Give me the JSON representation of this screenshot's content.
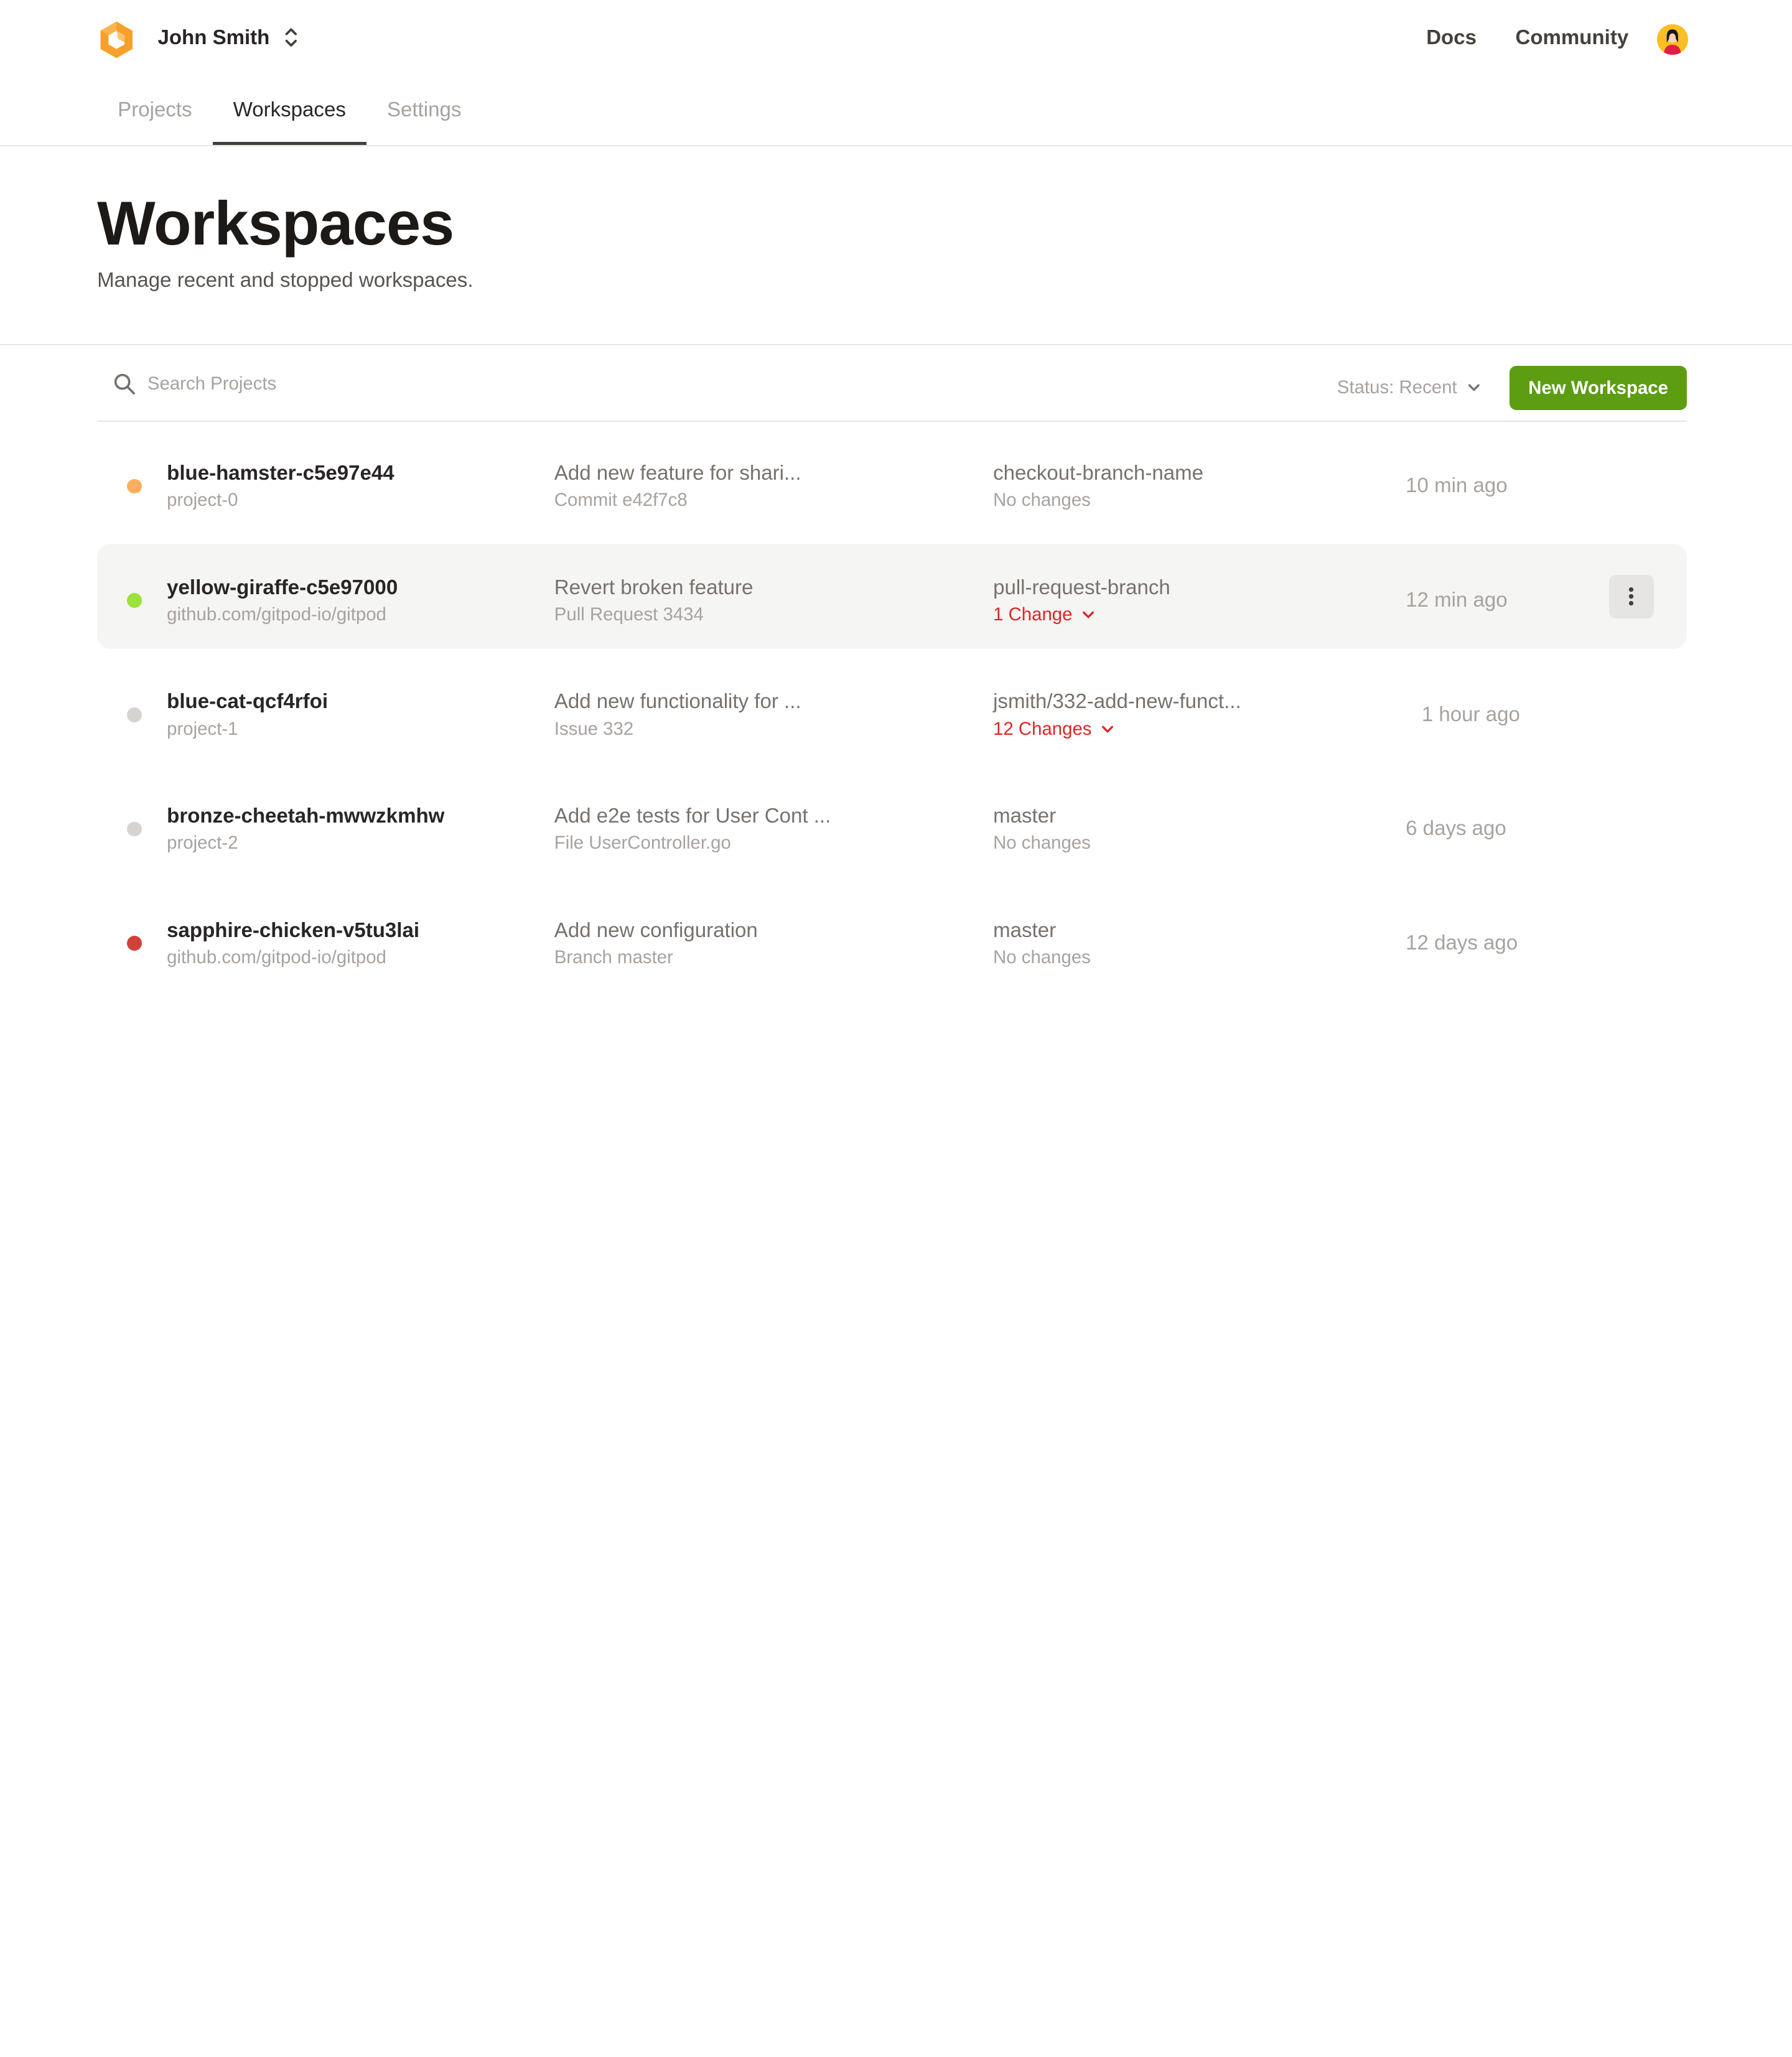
{
  "header": {
    "account_name": "John Smith",
    "links": {
      "docs": "Docs",
      "community": "Community"
    }
  },
  "tabs": [
    {
      "label": "Projects",
      "active": false
    },
    {
      "label": "Workspaces",
      "active": true
    },
    {
      "label": "Settings",
      "active": false
    }
  ],
  "page": {
    "title": "Workspaces",
    "subtitle": "Manage recent and stopped workspaces."
  },
  "toolbar": {
    "search_placeholder": "Search Projects",
    "status_filter": "Status: Recent",
    "new_workspace": "New Workspace"
  },
  "colors": {
    "accent_green": "#5c9d12",
    "status_orange": "#fdae5c",
    "status_green": "#9be23a",
    "status_gray": "#d6d3d1",
    "status_red": "#d0413c",
    "changes_red": "#dc2626"
  },
  "workspaces": [
    {
      "id": "blue-hamster-c5e97e44",
      "project": "project-0",
      "context": "Add new feature for shari...",
      "context_ref": "Commit e42f7c8",
      "branch": "checkout-branch-name",
      "changes": "No changes",
      "has_changes": false,
      "time": "10 min ago",
      "status": "orange"
    },
    {
      "id": "yellow-giraffe-c5e97000",
      "project": "github.com/gitpod-io/gitpod",
      "context": "Revert broken feature",
      "context_ref": "Pull Request 3434",
      "branch": "pull-request-branch",
      "changes": "1 Change",
      "has_changes": true,
      "time": "12 min ago",
      "status": "green"
    },
    {
      "id": "blue-cat-qcf4rfoi",
      "project": "project-1",
      "context": "Add new functionality for ...",
      "context_ref": "Issue 332",
      "branch": "jsmith/332-add-new-funct...",
      "changes": "12 Changes",
      "has_changes": true,
      "time": "1 hour ago",
      "status": "gray"
    },
    {
      "id": "bronze-cheetah-mwwzkmhw",
      "project": "project-2",
      "context": "Add e2e tests for User Cont ...",
      "context_ref": "File UserController.go",
      "branch": "master",
      "changes": "No changes",
      "has_changes": false,
      "time": "6 days ago",
      "status": "gray"
    },
    {
      "id": "sapphire-chicken-v5tu3lai",
      "project": "github.com/gitpod-io/gitpod",
      "context": "Add new configuration",
      "context_ref": "Branch master",
      "branch": "master",
      "changes": "No changes",
      "has_changes": false,
      "time": "12 days ago",
      "status": "red"
    }
  ]
}
